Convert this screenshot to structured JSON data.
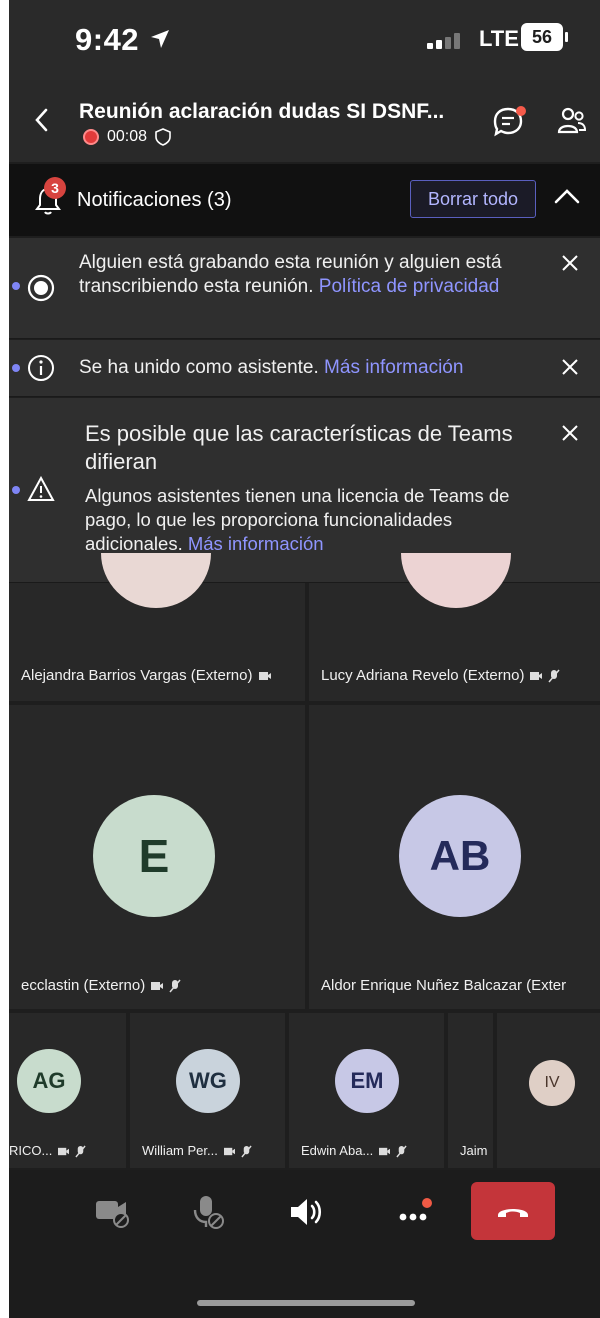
{
  "status": {
    "time": "9:42",
    "network": "LTE",
    "battery": "56"
  },
  "header": {
    "title": "Reunión aclaración dudas SI DSNF...",
    "recording_time": "00:08"
  },
  "notifications": {
    "title": "Notificaciones (3)",
    "badge": "3",
    "clear_all": "Borrar todo",
    "items": [
      {
        "text": "Alguien está grabando esta reunión y alguien está transcribiendo esta reunión.",
        "link": "Política de privacidad"
      },
      {
        "text": "Se ha unido como asistente.",
        "link": "Más información"
      },
      {
        "title": "Es posible que las características de Teams difieran",
        "text": "Algunos asistentes tienen una licencia de Teams de pago, lo que les proporciona funcionalidades adicionales.",
        "link": "Más información"
      }
    ]
  },
  "participants_large": [
    {
      "name": "Alejandra Barrios Vargas (Externo)"
    },
    {
      "name": "Lucy Adriana Revelo (Externo)"
    },
    {
      "initials": "E",
      "name": "ecclastin (Externo)",
      "color": "#c8dccd",
      "text_color": "#1f3b2a"
    },
    {
      "initials": "AB",
      "name": "Aldor Enrique Nuñez Balcazar (Exter",
      "color": "#c7c8e6",
      "text_color": "#242a5a"
    }
  ],
  "participants_small": [
    {
      "initials": "AG",
      "name": "RICO...",
      "color": "#c8dccd",
      "text_color": "#1f3b2a"
    },
    {
      "initials": "WG",
      "name": "William Per...",
      "color": "#c9d3dc",
      "text_color": "#1f2f40"
    },
    {
      "initials": "EM",
      "name": "Edwin Aba...",
      "color": "#c7c8e6",
      "text_color": "#242a5a"
    },
    {
      "initials": "",
      "name": "Jaim"
    },
    {
      "initials": "IV",
      "name": "",
      "color": "#dfcfc6",
      "text_color": "#4a362c"
    }
  ],
  "colors": {
    "accent": "#7f85f5",
    "hangup": "#c4353a",
    "record": "#e23a3a"
  }
}
